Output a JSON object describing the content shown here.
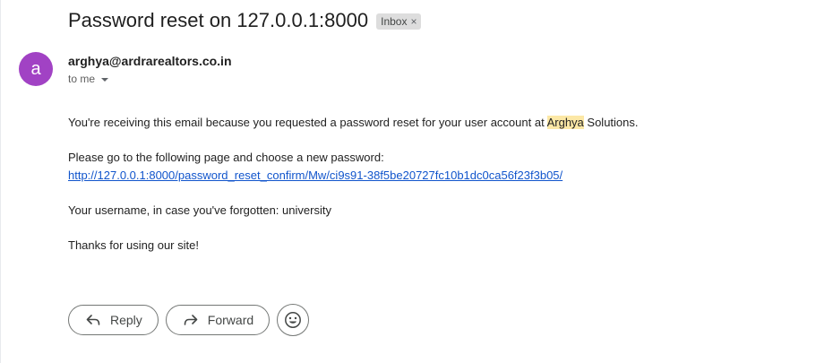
{
  "email": {
    "subject": "Password reset on 127.0.0.1:8000",
    "label": "Inbox",
    "label_remove": "×",
    "avatar_letter": "a",
    "avatar_color": "#a142c4",
    "sender": "arghya@ardrarealtors.co.in",
    "recipient": "to me"
  },
  "body": {
    "line1_before": "You're receiving this email because you requested a password reset for your user account at ",
    "line1_highlight": "Arghya",
    "line1_after": " Solutions.",
    "line2": "Please go to the following page and choose a new password:",
    "reset_link": "http://127.0.0.1:8000/password_reset_confirm/Mw/ci9s91-38f5be20727fc10b1dc0ca56f23f3b05/",
    "line3": "Your username, in case you've forgotten: university",
    "line4": "Thanks for using our site!"
  },
  "actions": {
    "reply_label": "Reply",
    "reply_icon": "reply-icon",
    "forward_label": "Forward",
    "forward_icon": "forward-icon",
    "emoji_icon": "emoji-icon"
  }
}
